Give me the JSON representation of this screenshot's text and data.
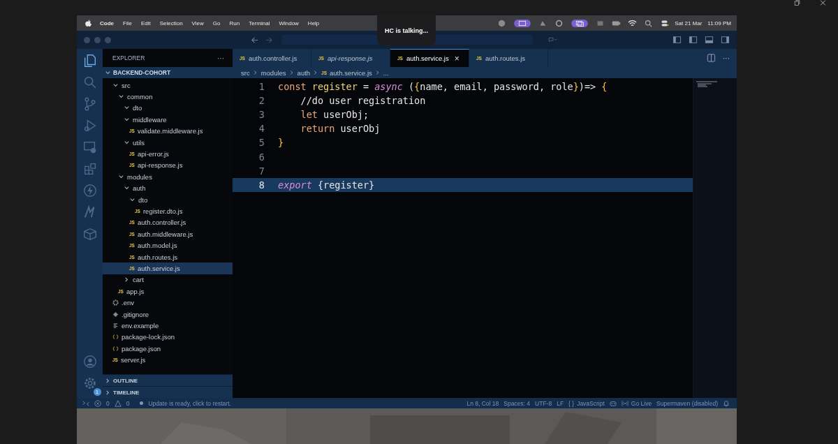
{
  "menu_bar": {
    "items": [
      "Code",
      "File",
      "Edit",
      "Selection",
      "View",
      "Go",
      "Run",
      "Terminal",
      "Window",
      "Help"
    ],
    "date": "Sat 21 Mar",
    "time": "11:09 PM"
  },
  "notice": "HC is talking...",
  "sidebar": {
    "title": "EXPLORER",
    "more": "···",
    "root": "BACKEND-COHORT",
    "tree": [
      {
        "label": "src",
        "kind": "folder",
        "expanded": true,
        "selected": false,
        "children": [
          {
            "label": "common",
            "kind": "folder",
            "expanded": true,
            "selected": false,
            "children": [
              {
                "label": "dto",
                "kind": "folder",
                "expanded": true,
                "selected": false
              },
              {
                "label": "middleware",
                "kind": "folder",
                "expanded": true,
                "selected": false,
                "children": [
                  {
                    "label": "validate.middleware.js",
                    "kind": "js",
                    "icon": "JS",
                    "selected": false
                  }
                ]
              },
              {
                "label": "utils",
                "kind": "folder",
                "expanded": true,
                "selected": false,
                "children": [
                  {
                    "label": "api-error.js",
                    "kind": "js",
                    "icon": "JS",
                    "selected": false
                  },
                  {
                    "label": "api-response.js",
                    "kind": "js",
                    "icon": "JS",
                    "selected": false
                  }
                ]
              }
            ]
          },
          {
            "label": "modules",
            "kind": "folder",
            "expanded": true,
            "selected": false,
            "children": [
              {
                "label": "auth",
                "kind": "folder",
                "expanded": true,
                "selected": false,
                "children": [
                  {
                    "label": "dto",
                    "kind": "folder",
                    "expanded": true,
                    "selected": false,
                    "children": [
                      {
                        "label": "register.dto.js",
                        "kind": "js",
                        "icon": "JS",
                        "selected": false
                      }
                    ]
                  },
                  {
                    "label": "auth.controller.js",
                    "kind": "js",
                    "icon": "JS",
                    "selected": false
                  },
                  {
                    "label": "auth.middleware.js",
                    "kind": "js",
                    "icon": "JS",
                    "selected": false
                  },
                  {
                    "label": "auth.model.js",
                    "kind": "js",
                    "icon": "JS",
                    "selected": false
                  },
                  {
                    "label": "auth.routes.js",
                    "kind": "js",
                    "icon": "JS",
                    "selected": false
                  },
                  {
                    "label": "auth.service.js",
                    "kind": "js",
                    "icon": "JS",
                    "selected": true
                  }
                ]
              },
              {
                "label": "cart",
                "kind": "folder",
                "expanded": false,
                "selected": false
              }
            ]
          },
          {
            "label": "app.js",
            "kind": "js",
            "icon": "JS",
            "selected": false
          }
        ]
      },
      {
        "label": ".env",
        "kind": "env",
        "selected": false
      },
      {
        "label": ".gitignore",
        "kind": "git",
        "selected": false
      },
      {
        "label": "env.example",
        "kind": "text",
        "selected": false
      },
      {
        "label": "package-lock.json",
        "kind": "json",
        "selected": false
      },
      {
        "label": "package.json",
        "kind": "json",
        "selected": false
      },
      {
        "label": "server.js",
        "kind": "js",
        "icon": "JS",
        "selected": false
      }
    ],
    "sections": [
      "OUTLINE",
      "TIMELINE"
    ],
    "settings_badge": "1"
  },
  "tabs": [
    {
      "icon": "JS",
      "label": "auth.controller.js",
      "selected": false,
      "preview": false
    },
    {
      "icon": "JS",
      "label": "api-response.js",
      "selected": false,
      "preview": true
    },
    {
      "icon": "JS",
      "label": "auth.service.js",
      "selected": true,
      "preview": false
    },
    {
      "icon": "JS",
      "label": "auth.routes.js",
      "selected": false,
      "preview": false
    }
  ],
  "tab_close": "×",
  "tab_more": "···",
  "breadcrumbs": [
    {
      "label": "src"
    },
    {
      "label": "modules"
    },
    {
      "label": "auth"
    },
    {
      "icon": "JS",
      "label": "auth.service.js"
    },
    {
      "label": "..."
    }
  ],
  "code": {
    "lines": [
      {
        "n": "1",
        "current": false,
        "tokens": [
          {
            "t": "const ",
            "kind": "keyword"
          },
          {
            "t": "register",
            "kind": "func"
          },
          {
            "t": " = ",
            "kind": "op"
          },
          {
            "t": "async",
            "kind": "storage"
          },
          {
            "t": " (",
            "kind": "plain"
          },
          {
            "t": "{",
            "kind": "brace"
          },
          {
            "t": "name, email, password, role",
            "kind": "param"
          },
          {
            "t": "}",
            "kind": "brace"
          },
          {
            "t": ")=> ",
            "kind": "plain"
          },
          {
            "t": "{",
            "kind": "brace"
          }
        ]
      },
      {
        "n": "2",
        "current": false,
        "tokens": [
          {
            "t": "    //do user registration",
            "kind": "comment"
          }
        ]
      },
      {
        "n": "3",
        "current": false,
        "tokens": [
          {
            "t": "    let ",
            "kind": "keyword"
          },
          {
            "t": "userObj;",
            "kind": "plain"
          }
        ]
      },
      {
        "n": "4",
        "current": false,
        "tokens": [
          {
            "t": "    return ",
            "kind": "keyword"
          },
          {
            "t": "userObj",
            "kind": "plain"
          }
        ]
      },
      {
        "n": "5",
        "current": false,
        "tokens": [
          {
            "t": "}",
            "kind": "brace"
          }
        ]
      },
      {
        "n": "6",
        "current": false
      },
      {
        "n": "7",
        "current": false
      },
      {
        "n": "8",
        "current": true,
        "tokens": [
          {
            "t": "export",
            "kind": "storage"
          },
          {
            "t": " {register}",
            "kind": "plain"
          }
        ]
      }
    ]
  },
  "status_bar": {
    "errors": "0",
    "warnings": "0",
    "message": "Update is ready, click to restart.",
    "position": "Ln 8, Col 18",
    "spaces": "Spaces: 4",
    "encoding": "UTF-8",
    "eol": "LF",
    "language_icon": "{ }",
    "language": "JavaScript",
    "live": "Go Live",
    "extension": "Supermaven (disabled)"
  }
}
